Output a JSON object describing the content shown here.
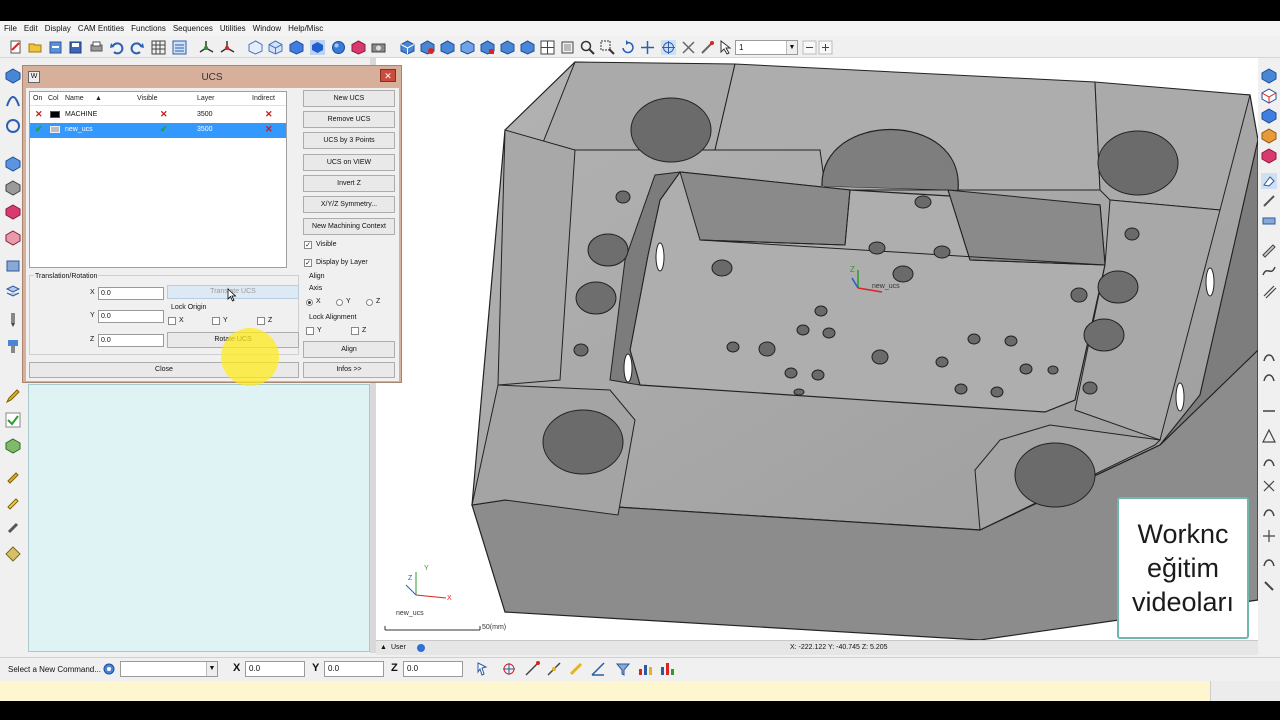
{
  "menu": [
    "File",
    "Edit",
    "Display",
    "CAM Entities",
    "Functions",
    "Sequences",
    "Utilities",
    "Window",
    "Help/Misc"
  ],
  "toolbar": {
    "layer_value": "1"
  },
  "dialog": {
    "title": "UCS",
    "columns": [
      "On",
      "Col",
      "Name",
      "Visible",
      "Layer",
      "Indirect"
    ],
    "rows": [
      {
        "name": "MACHINE",
        "layer": "3500",
        "color": "#000000"
      },
      {
        "name": "new_ucs",
        "layer": "3500",
        "color": "#bdbdbd"
      }
    ],
    "buttons": {
      "new_ucs": "New UCS",
      "remove_ucs": "Remove UCS",
      "ucs_by_3_points": "UCS by 3 Points",
      "ucs_on_view": "UCS on VIEW",
      "invert_z": "Invert Z",
      "symmetry": "X/Y/Z Symmetry...",
      "new_machining_context": "New Machining Context",
      "translate_ucs": "Translate UCS",
      "rotate_ucs": "Rotate UCS",
      "align": "Align",
      "close": "Close",
      "infos": "Infos >>"
    },
    "visible_label": "Visible",
    "display_by_layer_label": "Display by Layer",
    "translation_group": "Translation/Rotation",
    "x_label": "X",
    "y_label": "Y",
    "z_label": "Z",
    "x_value": "0.0",
    "y_value": "0.0",
    "z_value": "0.0",
    "lock_origin": "Lock Origin",
    "align_group": "Align",
    "axis_label": "Axis",
    "lock_alignment": "Lock Alignment"
  },
  "viewport": {
    "ucs_label": "new_ucs",
    "triad_label": "new_ucs",
    "scale": "50(mm)",
    "mode": "User",
    "coords": "X: -222.122   Y: -40.745   Z: 5.205"
  },
  "overlay": [
    "Worknc",
    "eğitim",
    "videoları"
  ],
  "commandbar": {
    "prompt": "Select a New Command...",
    "x_label": "X",
    "y_label": "Y",
    "z_label": "Z",
    "x_value": "0.0",
    "y_value": "0.0",
    "z_value": "0.0"
  },
  "colors": {
    "dialog_frame": "#d6b09a",
    "selection": "#3399ff",
    "part_gray": "#a5a5a5",
    "status_yellow": "#fdf6cf"
  }
}
